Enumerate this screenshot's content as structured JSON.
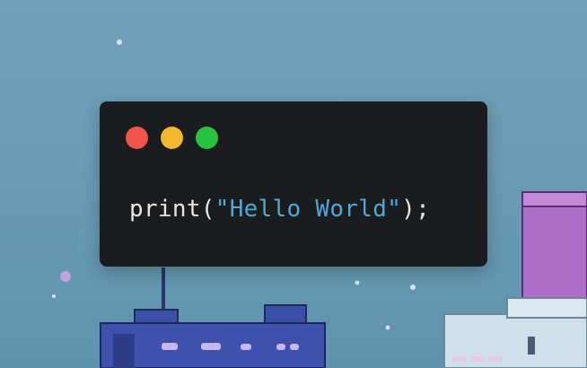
{
  "window": {
    "controls": [
      {
        "name": "close",
        "color": "#f0544c"
      },
      {
        "name": "minimize",
        "color": "#f4b82e"
      },
      {
        "name": "maximize",
        "color": "#28c43f"
      }
    ]
  },
  "code": {
    "function_name": "print",
    "open_paren": "(",
    "string_literal": "\"Hello World\"",
    "close": ");",
    "colors": {
      "text": "#e6e6e6",
      "string": "#4fa8d6",
      "background": "#1b1c1e"
    }
  }
}
